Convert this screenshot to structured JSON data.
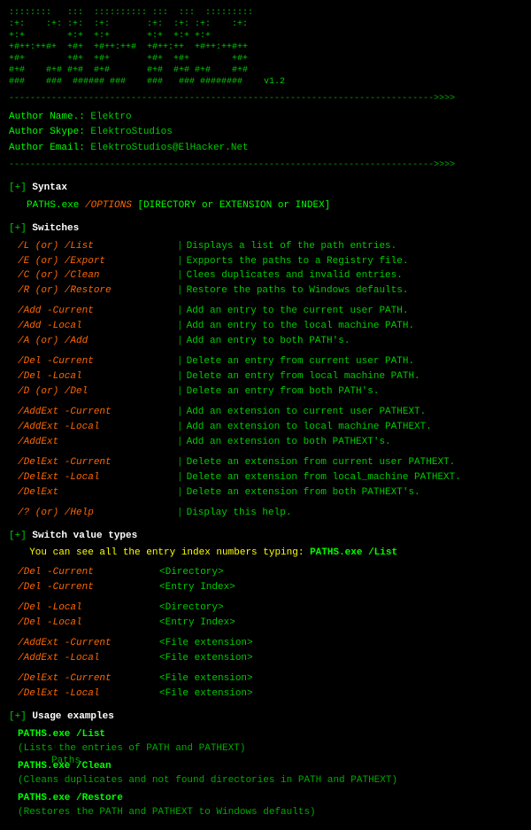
{
  "ascii_art": {
    "lines": [
      "::::::::   :::  :::::::::: :::  :::  :::::::::",
      ":+:    :+: :+:  :+:       :+:  :+: :+:    :+:",
      "+:+        +:+  +:+       +:+  +:+ +:+",
      "+#++:++#+  +#+  +#++:++#  +#++:++  +#++:++#++",
      "+#+        +#+  +#+       +#+  +#+        +#+",
      "#+#    #+# #+#  #+#       #+#  #+# #+#    #+#",
      "###    ###  ###### ###    ###   ### ########    v1.2"
    ],
    "ascii_raw": "::::::::   :::  :::::::::: :::  :::  :::::::::\n:+:    :+: :+:  :+:       :+:  :+: :+:    :+:\n+:+        +:+  +:+       +:+  +:+ +:+\n+#++:++#+  +#+  +#++:++#  +#++:++  +#++:++#++\n+#+        +#+  +#+       +#+  +#+        +#+\n#+#    #+# #+#  #+#       #+#  #+# #+#    #+#\n###    ###  ###### ###    ###   ### ########    v1.2"
  },
  "divider1": "-------------------------------------------------------------------------------->>>>",
  "author": {
    "name_label": "Author Name.: ",
    "name_value": "Elektro",
    "skype_label": "Author Skype: ",
    "skype_value": "ElektroStudios",
    "email_label": "Author Email: ",
    "email_value": "ElektroStudios@ElHacker.Net"
  },
  "divider2": "-------------------------------------------------------------------------------->>>>",
  "sections": {
    "syntax": {
      "header": "[+] Syntax",
      "content": "PATHS.exe /OPTIONS [DIRECTORY or EXTENSION or INDEX]",
      "exe": "PATHS.exe",
      "option": "/OPTIONS",
      "bracket": "[DIRECTORY or EXTENSION or INDEX]"
    },
    "switches": {
      "header": "[+] Switches",
      "items": [
        {
          "cmd": "/L (or) /List  ",
          "desc": "Displays a list of the path entries."
        },
        {
          "cmd": "/E (or) /Export",
          "desc": "Expports the paths to a Registry file."
        },
        {
          "cmd": "/C (or) /Clean ",
          "desc": "Clees duplicates and invalid entries."
        },
        {
          "cmd": "/R (or) /Restore",
          "desc": "Restore the paths to Windows defaults."
        },
        {
          "cmd": "",
          "desc": ""
        },
        {
          "cmd": "/Add -Current  ",
          "desc": "Add an entry to the current user PATH."
        },
        {
          "cmd": "/Add -Local    ",
          "desc": "Add an entry to the local machine PATH."
        },
        {
          "cmd": "/A (or) /Add   ",
          "desc": "Add an entry to both PATH's."
        },
        {
          "cmd": "",
          "desc": ""
        },
        {
          "cmd": "/Del -Current  ",
          "desc": "Delete an entry from current user PATH."
        },
        {
          "cmd": "/Del -Local    ",
          "desc": "Delete an entry from local machine PATH."
        },
        {
          "cmd": "/D (or) /Del   ",
          "desc": "Delete an entry from both PATH's."
        },
        {
          "cmd": "",
          "desc": ""
        },
        {
          "cmd": "/AddExt -Current",
          "desc": "Add an extension to current user PATHEXT."
        },
        {
          "cmd": "/AddExt -Local  ",
          "desc": "Add an extension to local machine PATHEXT."
        },
        {
          "cmd": "/AddExt        ",
          "desc": "Add an extension to both PATHEXT's."
        },
        {
          "cmd": "",
          "desc": ""
        },
        {
          "cmd": "/DelExt -Current",
          "desc": "Delete an extension from current user PATHEXT."
        },
        {
          "cmd": "/DelExt -Local  ",
          "desc": "Delete an extension from local_machine PATHEXT."
        },
        {
          "cmd": "/DelExt        ",
          "desc": "Delete an extension from both PATHEXT's."
        },
        {
          "cmd": "",
          "desc": ""
        },
        {
          "cmd": "/? (or) /Help  ",
          "desc": "Display this help."
        }
      ]
    },
    "switch_value_types": {
      "header": "[+] Switch value types",
      "info": "You can see all the entry index numbers typing: PATHS.exe /List",
      "items": [
        {
          "cmd": "/Del -Current  ",
          "type": "<Directory>"
        },
        {
          "cmd": "/Del -Current  ",
          "type": "<Entry Index>"
        },
        {
          "cmd": "",
          "type": ""
        },
        {
          "cmd": "/Del -Local    ",
          "type": "<Directory>"
        },
        {
          "cmd": "/Del -Local    ",
          "type": "<Entry Index>"
        },
        {
          "cmd": "",
          "type": ""
        },
        {
          "cmd": "/AddExt -Current",
          "type": "<File extension>"
        },
        {
          "cmd": "/AddExt -Local  ",
          "type": "<File extension>"
        },
        {
          "cmd": "",
          "type": ""
        },
        {
          "cmd": "/DelExt -Current",
          "type": "<File extension>"
        },
        {
          "cmd": "/DelExt -Local  ",
          "type": "<File extension>"
        }
      ]
    },
    "usage_examples": {
      "header": "[+] Usage examples",
      "items": [
        {
          "cmd": "PATHS.exe /List",
          "desc": "(Lists the entries of PATH and PATHEXT)"
        },
        {
          "cmd": "PATHS.exe /Clean",
          "desc": "(Cleans duplicates and not found directories in PATH and PATHEXT)"
        },
        {
          "cmd": "PATHS.exe /Restore",
          "desc": "(Restores the PATH and PATHEXT to Windows defaults)"
        }
      ]
    }
  },
  "footer": {
    "paths_label": "Paths"
  }
}
